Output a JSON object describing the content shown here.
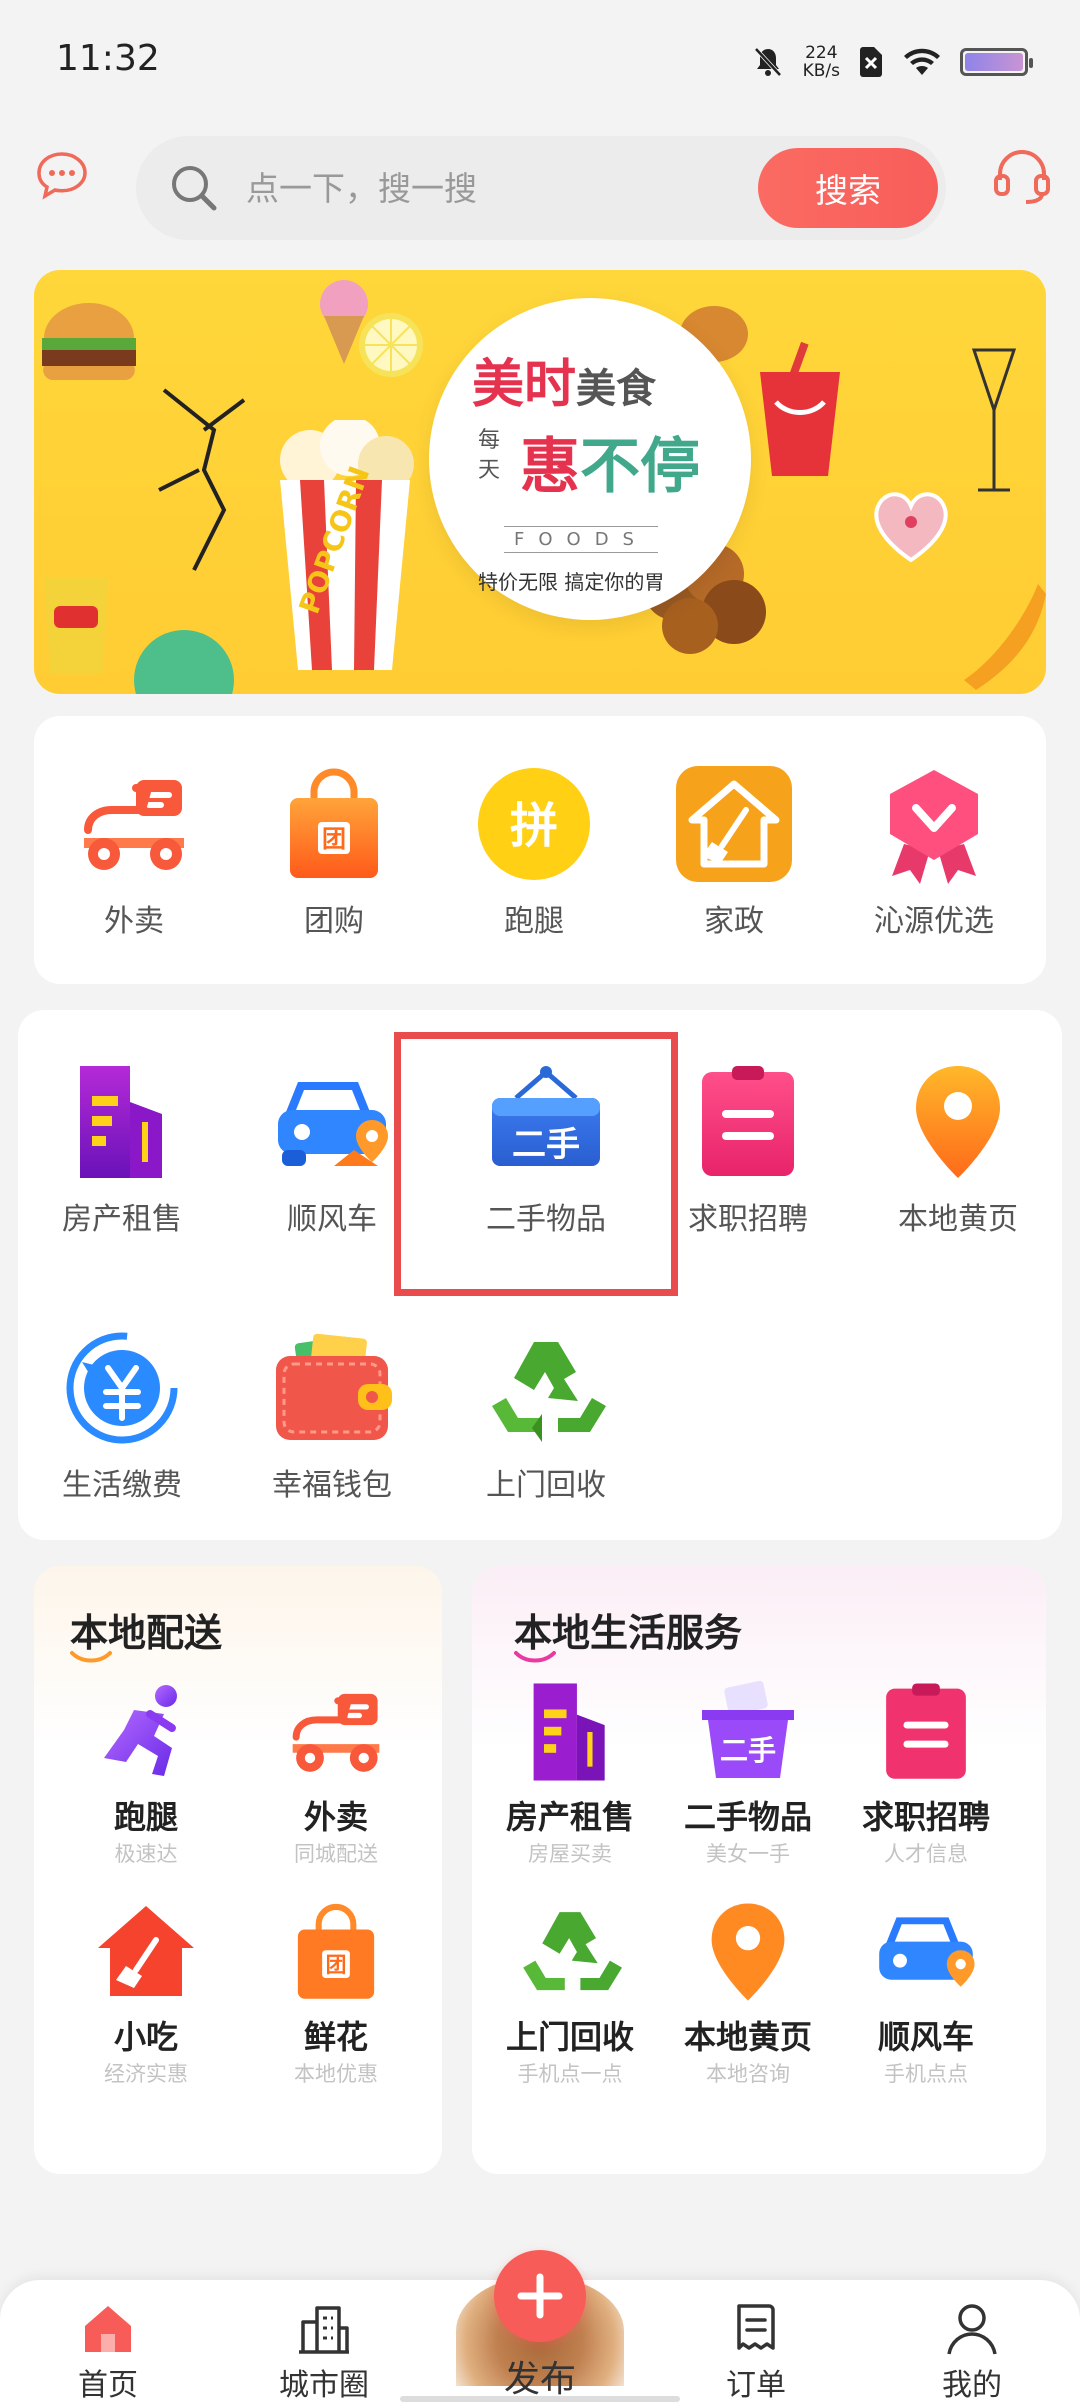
{
  "status_bar": {
    "time": "11:32",
    "net_speed_value": "224",
    "net_speed_unit": "KB/s"
  },
  "header": {
    "search": {
      "placeholder": "点一下，搜一搜",
      "button": "搜索"
    }
  },
  "banner": {
    "line1_a": "美时",
    "line1_b": "美食",
    "side_a": "每",
    "side_b": "天",
    "line2_a": "惠",
    "line2_b": "不停",
    "foods": "FOODS",
    "slogan": "特价无限 搞定你的胃"
  },
  "main_grid": [
    {
      "label": "外卖",
      "icon": "scooter-icon"
    },
    {
      "label": "团购",
      "icon": "group-bag-icon"
    },
    {
      "label": "跑腿",
      "icon": "pin-circle-icon"
    },
    {
      "label": "家政",
      "icon": "house-broom-icon"
    },
    {
      "label": "沁源优选",
      "icon": "ribbon-badge-icon"
    }
  ],
  "service_grid": [
    {
      "label": "房产租售",
      "icon": "building-icon"
    },
    {
      "label": "顺风车",
      "icon": "car-pin-icon"
    },
    {
      "label": "二手物品",
      "icon": "secondhand-sign-icon",
      "highlighted": true
    },
    {
      "label": "求职招聘",
      "icon": "clipboard-icon"
    },
    {
      "label": "本地黄页",
      "icon": "location-pin-icon"
    },
    {
      "label": "生活缴费",
      "icon": "yuan-refresh-icon"
    },
    {
      "label": "幸福钱包",
      "icon": "wallet-icon"
    },
    {
      "label": "上门回收",
      "icon": "recycle-icon"
    }
  ],
  "local_delivery": {
    "title": "本地配送",
    "items": [
      {
        "name": "跑腿",
        "sub": "极速达",
        "icon": "runner-icon"
      },
      {
        "name": "外卖",
        "sub": "同城配送",
        "icon": "scooter-icon"
      },
      {
        "name": "小吃",
        "sub": "经济实惠",
        "icon": "house-broom-icon"
      },
      {
        "name": "鲜花",
        "sub": "本地优惠",
        "icon": "group-bag-icon"
      }
    ]
  },
  "local_life": {
    "title": "本地生活服务",
    "items": [
      {
        "name": "房产租售",
        "sub": "房屋买卖",
        "icon": "building-icon"
      },
      {
        "name": "二手物品",
        "sub": "美女一手",
        "icon": "secondhand-basket-icon"
      },
      {
        "name": "求职招聘",
        "sub": "人才信息",
        "icon": "clipboard-icon"
      },
      {
        "name": "上门回收",
        "sub": "手机点一点",
        "icon": "recycle-icon"
      },
      {
        "name": "本地黄页",
        "sub": "本地咨询",
        "icon": "location-pin-icon"
      },
      {
        "name": "顺风车",
        "sub": "手机点点",
        "icon": "car-pin-icon"
      }
    ]
  },
  "bottom_nav": [
    {
      "label": "首页",
      "icon": "home-icon",
      "active": true
    },
    {
      "label": "城市圈",
      "icon": "city-icon"
    },
    {
      "label": "发布",
      "icon": "plus-icon"
    },
    {
      "label": "订单",
      "icon": "order-icon"
    },
    {
      "label": "我的",
      "icon": "user-icon"
    }
  ],
  "colors": {
    "accent": "#f85c58",
    "highlight_border": "#e84c4c",
    "banner_bg": "#ffd73a"
  }
}
